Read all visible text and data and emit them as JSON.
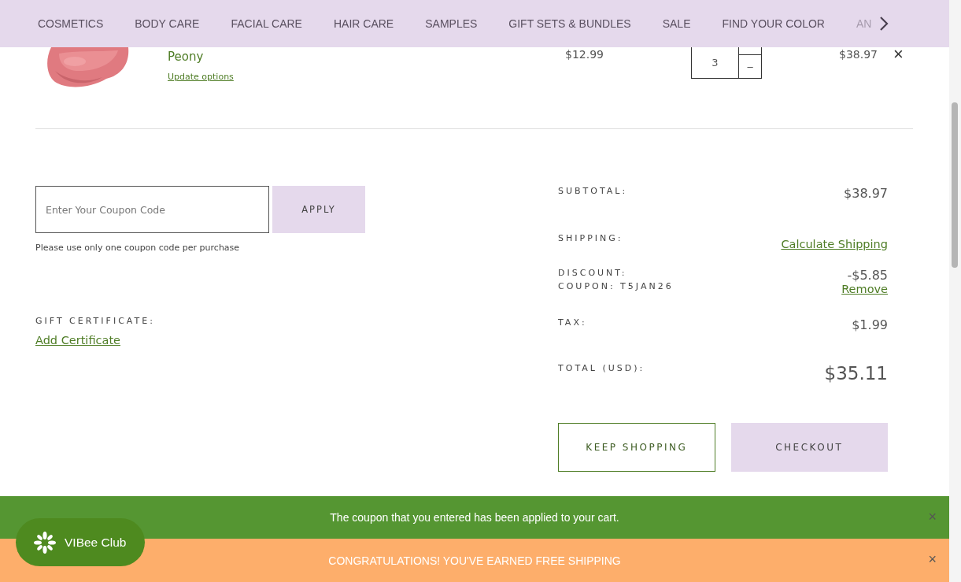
{
  "nav": {
    "items": [
      {
        "label": "COSMETICS"
      },
      {
        "label": "BODY CARE"
      },
      {
        "label": "FACIAL CARE"
      },
      {
        "label": "HAIR CARE"
      },
      {
        "label": "SAMPLES"
      },
      {
        "label": "GIFT SETS & BUNDLES"
      },
      {
        "label": "SALE"
      },
      {
        "label": "FIND YOUR COLOR"
      },
      {
        "label": "AN"
      }
    ]
  },
  "cart_item": {
    "kind": "picture",
    "name": "Peony",
    "update_link": "Update options",
    "price": "$12.99",
    "quantity": "3",
    "decrement": "–",
    "total": "$38.97",
    "remove": "×"
  },
  "coupon": {
    "placeholder": "Enter Your Coupon Code",
    "button": "APPLY",
    "note": "Please use only one coupon code per purchase"
  },
  "gift_certificate": {
    "label": "GIFT CERTIFICATE:",
    "link": "Add Certificate"
  },
  "summary": [
    {
      "kind": "value",
      "label": "SUBTOTAL:",
      "value": "$38.97"
    },
    {
      "kind": "link",
      "label": "SHIPPING:",
      "value": "Calculate Shipping"
    },
    {
      "kind": "discount",
      "label": "DISCOUNT:",
      "sublabel": "COUPON: T5JAN26",
      "value": "-$5.85",
      "link": "Remove"
    },
    {
      "kind": "value",
      "label": "TAX:",
      "value": "$1.99"
    },
    {
      "kind": "total",
      "label": "TOTAL (USD):",
      "value": "$35.11"
    }
  ],
  "buttons": {
    "keep_shopping": "KEEP SHOPPING",
    "checkout": "CHECKOUT"
  },
  "banners": [
    {
      "text": "The coupon that you entered has been applied to your cart.",
      "close": "×",
      "color": "#559632"
    },
    {
      "text": "CONGRATULATIONS! YOU'VE EARNED FREE SHIPPING",
      "close": "×",
      "color": "#fdae6b"
    }
  ],
  "club_button": {
    "label": "VIBee Club"
  }
}
